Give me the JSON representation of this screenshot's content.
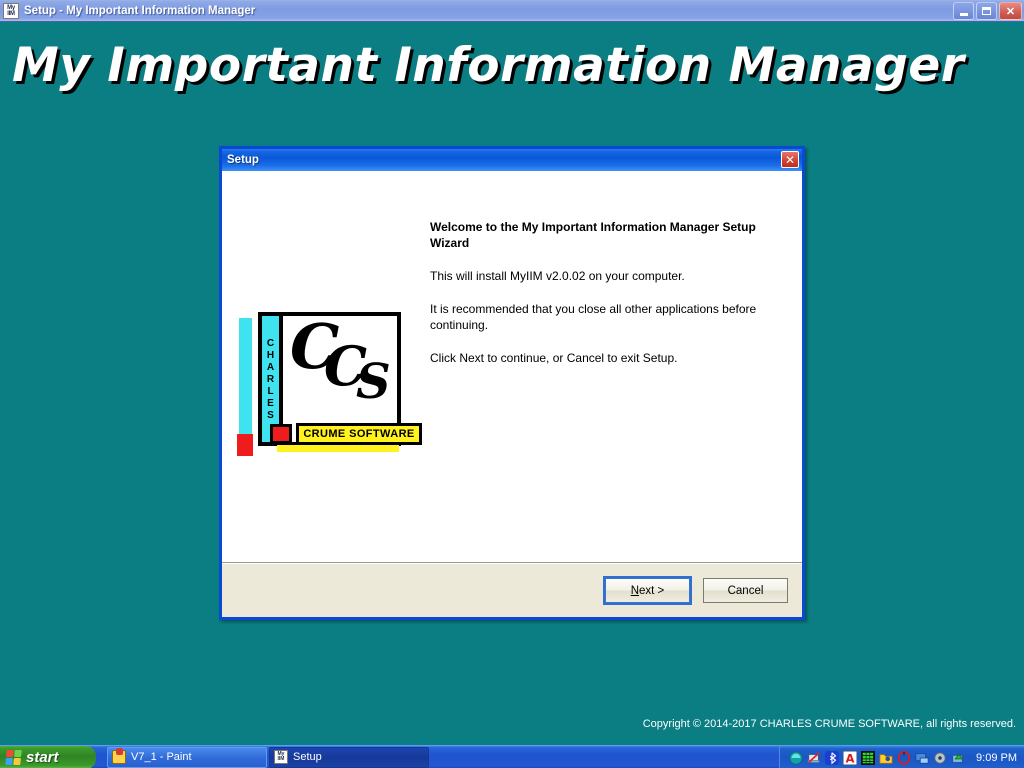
{
  "desktop": {
    "background_color": "#0a7e82",
    "banner_text": "My Important Information Manager",
    "copyright": "Copyright © 2014-2017 CHARLES CRUME SOFTWARE, all rights reserved."
  },
  "outer_window": {
    "title": "Setup - My Important Information Manager",
    "icon_line1": "My",
    "icon_line2": "IIM",
    "controls": {
      "minimize": "minimize-button",
      "maximize": "restore-button",
      "close": "✕"
    }
  },
  "dialog": {
    "title": "Setup",
    "close_label": "✕",
    "heading": "Welcome to the My Important Information Manager Setup Wizard",
    "paragraphs": [
      "This will install MyIIM v2.0.02 on your computer.",
      "It is recommended that you close all other applications before continuing.",
      "Click Next to continue, or Cancel to exit Setup."
    ],
    "buttons": {
      "next_accel": "N",
      "next_rest": "ext >",
      "cancel": "Cancel"
    },
    "accent_color": "#0a49d6",
    "footer_color": "#ece9d8"
  },
  "logo": {
    "charles_letters": [
      "C",
      "H",
      "A",
      "R",
      "L",
      "E",
      "S"
    ],
    "ccs": [
      "C",
      "C",
      "S"
    ],
    "banner": "CRUME SOFTWARE",
    "colors": {
      "cyan": "#3fe3f0",
      "yellow": "#fff21f",
      "red": "#ee1c1c"
    }
  },
  "taskbar": {
    "start_label": "start",
    "tasks": [
      {
        "label": "V7_1 - Paint",
        "icon": "paint-icon",
        "active": false
      },
      {
        "label": "Setup",
        "icon": "myiim-icon",
        "active": true
      }
    ],
    "tray_icons": [
      "teal-orb-icon",
      "network-disconnected-icon",
      "bluetooth-icon",
      "red-a-icon",
      "green-bars-icon",
      "yellow-folder-icon",
      "red-circle-icon",
      "blue-screen-icon",
      "gray-disc-icon",
      "green-arrow-icon"
    ],
    "clock": "9:09 PM"
  }
}
